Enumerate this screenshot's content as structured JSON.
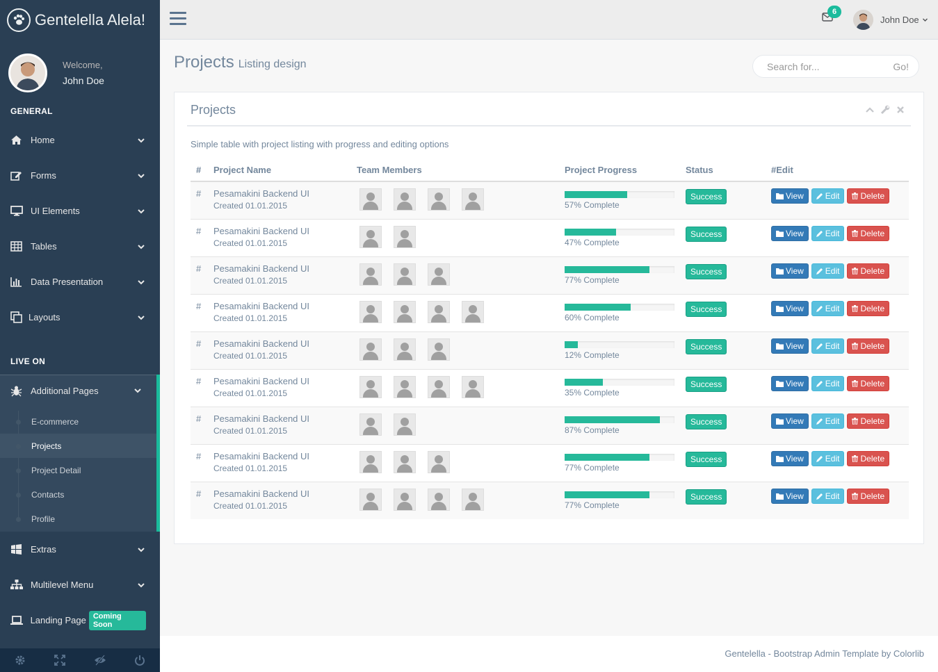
{
  "brand": {
    "title": "Gentelella Alela!"
  },
  "profile": {
    "welcome": "Welcome,",
    "name": "John Doe"
  },
  "sections": {
    "general": "GENERAL",
    "live_on": "LIVE ON"
  },
  "menu_general": [
    {
      "label": "Home",
      "icon": "home-icon"
    },
    {
      "label": "Forms",
      "icon": "edit-icon"
    },
    {
      "label": "UI Elements",
      "icon": "desktop-icon"
    },
    {
      "label": "Tables",
      "icon": "table-icon"
    },
    {
      "label": "Data Presentation",
      "icon": "bar-chart-icon"
    },
    {
      "label": "Layouts",
      "icon": "clone-icon"
    }
  ],
  "menu_live": {
    "additional_pages": "Additional Pages",
    "submenu": [
      "E-commerce",
      "Projects",
      "Project Detail",
      "Contacts",
      "Profile"
    ],
    "current_sub": "Projects",
    "extras": "Extras",
    "multilevel": "Multilevel Menu",
    "landing": "Landing Page",
    "coming_soon": "Coming Soon"
  },
  "topnav": {
    "mail_count": "6",
    "user_name": "John Doe"
  },
  "page": {
    "title": "Projects",
    "subtitle": "Listing design"
  },
  "search": {
    "placeholder": "Search for...",
    "button": "Go!"
  },
  "panel": {
    "title": "Projects",
    "description": "Simple table with project listing with progress and editing options"
  },
  "table": {
    "headers": [
      "#",
      "Project Name",
      "Team Members",
      "Project Progress",
      "Status",
      "#Edit"
    ],
    "buttons": {
      "view": "View",
      "edit": "Edit",
      "delete": "Delete"
    },
    "rows": [
      {
        "hash": "#",
        "name": "Pesamakini Backend UI",
        "created": "Created 01.01.2015",
        "members": 4,
        "progress": 57,
        "progress_label": "57% Complete",
        "status": "Success"
      },
      {
        "hash": "#",
        "name": "Pesamakini Backend UI",
        "created": "Created 01.01.2015",
        "members": 2,
        "progress": 47,
        "progress_label": "47% Complete",
        "status": "Success"
      },
      {
        "hash": "#",
        "name": "Pesamakini Backend UI",
        "created": "Created 01.01.2015",
        "members": 3,
        "progress": 77,
        "progress_label": "77% Complete",
        "status": "Success"
      },
      {
        "hash": "#",
        "name": "Pesamakini Backend UI",
        "created": "Created 01.01.2015",
        "members": 4,
        "progress": 60,
        "progress_label": "60% Complete",
        "status": "Success"
      },
      {
        "hash": "#",
        "name": "Pesamakini Backend UI",
        "created": "Created 01.01.2015",
        "members": 3,
        "progress": 12,
        "progress_label": "12% Complete",
        "status": "Success"
      },
      {
        "hash": "#",
        "name": "Pesamakini Backend UI",
        "created": "Created 01.01.2015",
        "members": 4,
        "progress": 35,
        "progress_label": "35% Complete",
        "status": "Success"
      },
      {
        "hash": "#",
        "name": "Pesamakini Backend UI",
        "created": "Created 01.01.2015",
        "members": 2,
        "progress": 87,
        "progress_label": "87% Complete",
        "status": "Success"
      },
      {
        "hash": "#",
        "name": "Pesamakini Backend UI",
        "created": "Created 01.01.2015",
        "members": 3,
        "progress": 77,
        "progress_label": "77% Complete",
        "status": "Success"
      },
      {
        "hash": "#",
        "name": "Pesamakini Backend UI",
        "created": "Created 01.01.2015",
        "members": 4,
        "progress": 77,
        "progress_label": "77% Complete",
        "status": "Success"
      }
    ]
  },
  "footer": {
    "text": "Gentelella - Bootstrap Admin Template by Colorlib"
  },
  "colors": {
    "sidebar": "#2A3F54",
    "accent": "#1ABB9C",
    "success": "#26B99A",
    "view": "#337AB7",
    "edit": "#5BC0DE",
    "delete": "#D9534F"
  }
}
